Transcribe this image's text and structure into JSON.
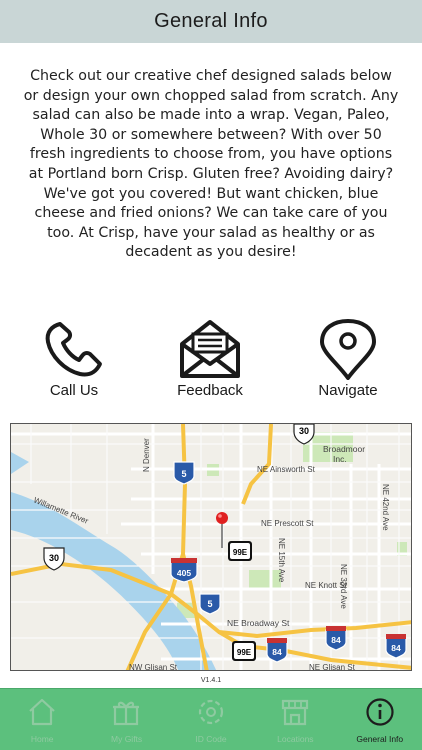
{
  "header": {
    "title": "General Info"
  },
  "description": "Check out our creative chef designed salads below or design your own chopped salad from scratch. Any salad can also be made into a wrap. Vegan, Paleo, Whole 30 or somewhere between? With over 50 fresh ingredients to choose from, you have options at Portland born Crisp. Gluten free? Avoiding dairy? We've got you covered! But want chicken, blue cheese and fried onions? We can take care of you too. At Crisp, have your salad as healthy or as decadent as you desire!",
  "actions": [
    {
      "label": "Call Us",
      "icon": "phone-icon"
    },
    {
      "label": "Feedback",
      "icon": "envelope-icon"
    },
    {
      "label": "Navigate",
      "icon": "location-pin-icon"
    }
  ],
  "map": {
    "labels": {
      "n_denver": "N Denver",
      "ne_ainsworth": "NE Ainsworth St",
      "broadmoor": "Broadmoor",
      "broadmoor2": "Inc.",
      "ne_42nd": "NE 42nd Ave",
      "willamette": "Willamette River",
      "ne_prescott": "NE Prescott St",
      "ne_15th": "NE 15th Ave",
      "ne_knott": "NE Knott St",
      "ne_33rd": "NE 33rd Ave",
      "ne_broadway": "NE Broadway St",
      "nw_glisan": "NW Glisan St",
      "ne_glisan": "NE Glisan St"
    },
    "shields": {
      "us30_top": "30",
      "us30_left": "30",
      "i5_top": "5",
      "i405": "405",
      "i5_mid": "5",
      "or99e_a": "99E",
      "or99e_b": "99E",
      "i84_a": "84",
      "i84_b": "84",
      "i84_c": "84"
    }
  },
  "version": "V1.4.1",
  "tabs": [
    {
      "label": "Home",
      "icon": "home-icon",
      "active": false
    },
    {
      "label": "My Gifts",
      "icon": "gift-icon",
      "active": false
    },
    {
      "label": "ID Code",
      "icon": "id-code-icon",
      "active": false
    },
    {
      "label": "Locations",
      "icon": "store-icon",
      "active": false
    },
    {
      "label": "General Info",
      "icon": "info-icon",
      "active": true
    }
  ],
  "colors": {
    "header_bg": "#c9d6d6",
    "tabbar_bg": "#5cc07d",
    "tab_inactive": "#8fcaa1",
    "tab_active": "#1d1d1d",
    "map_water": "#a9d3ec",
    "map_park": "#cde8b8",
    "map_highway": "#f6c343",
    "pin": "#e02020"
  }
}
